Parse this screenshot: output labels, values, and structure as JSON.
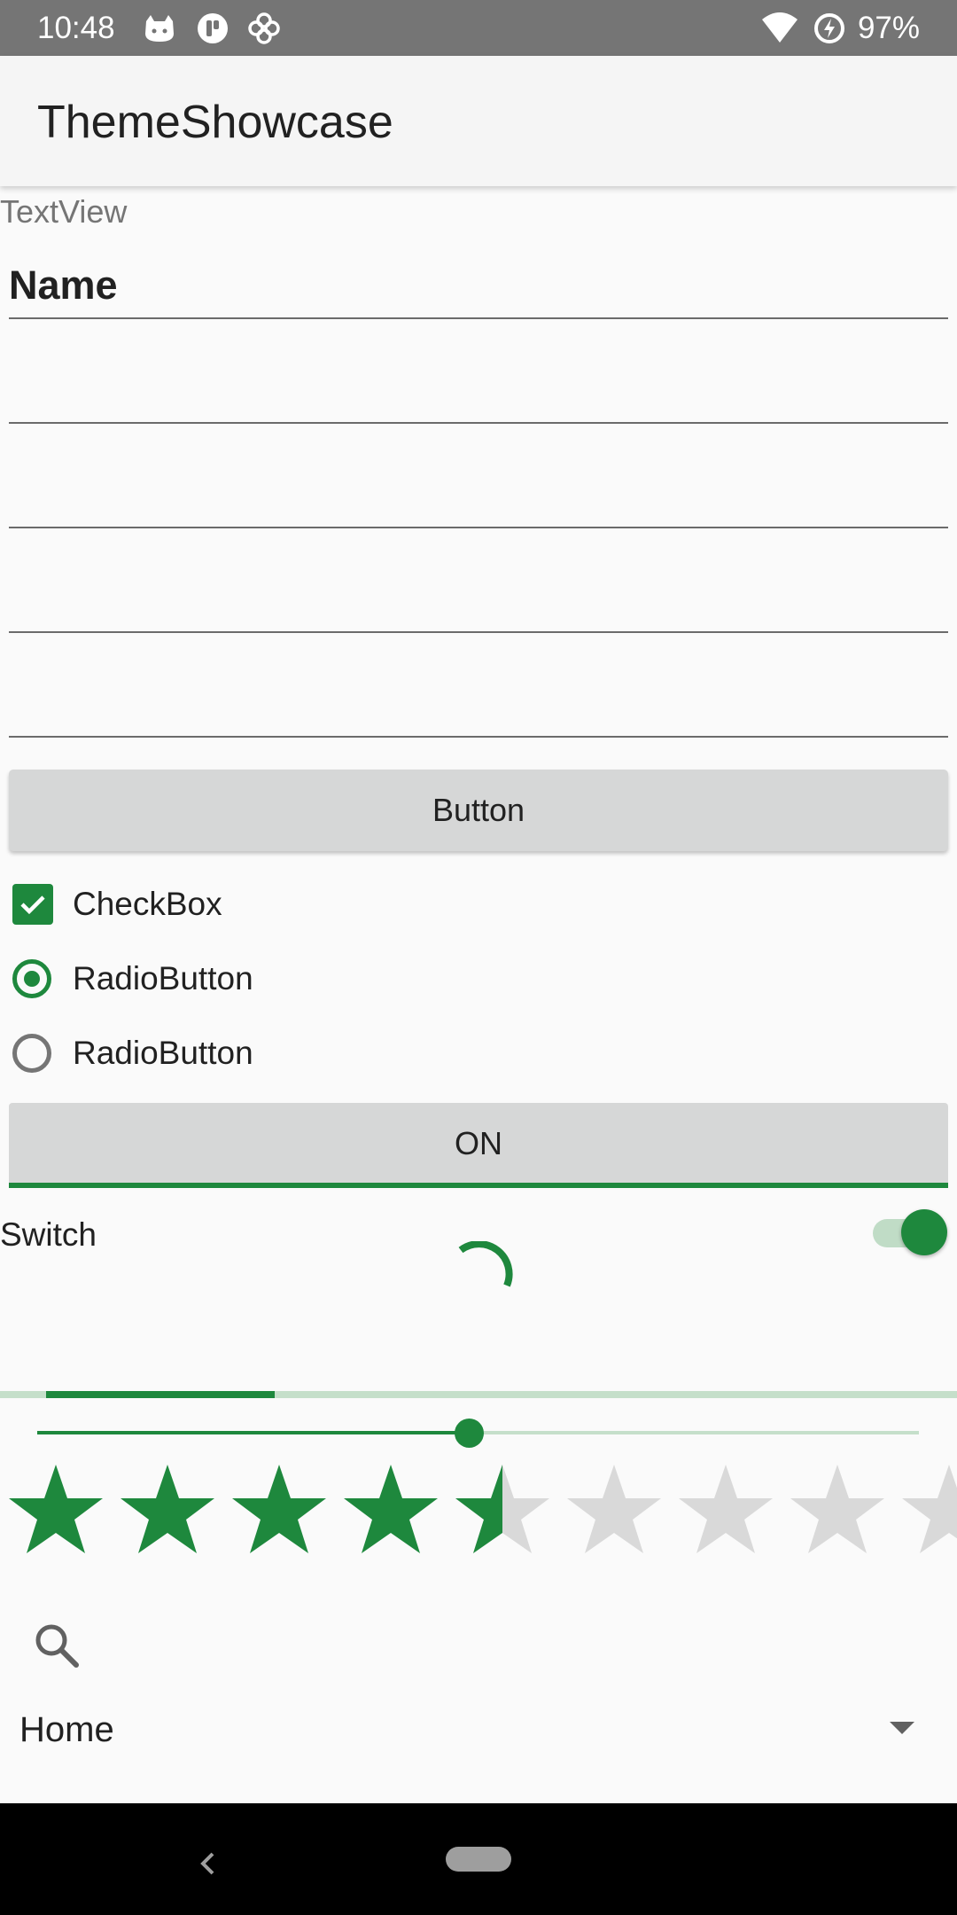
{
  "status_bar": {
    "time": "10:48",
    "battery_percent": "97%",
    "icons": [
      "cat-notification-icon",
      "podcast-notification-icon",
      "pinwheel-notification-icon",
      "wifi-icon",
      "battery-saver-icon"
    ]
  },
  "app_bar": {
    "title": "ThemeShowcase"
  },
  "content": {
    "textview_label": "TextView",
    "name_field_value": "Name",
    "empty_fields_count": 4,
    "button_label": "Button",
    "checkbox": {
      "label": "CheckBox",
      "checked": true
    },
    "radio_1": {
      "label": "RadioButton",
      "checked": true
    },
    "radio_2": {
      "label": "RadioButton",
      "checked": false
    },
    "toggle_button_label": "ON",
    "switch": {
      "label": "Switch",
      "on": true
    },
    "progress_fraction": 0.24,
    "slider_fraction": 0.49,
    "rating": {
      "value": 4.5,
      "max": 9
    },
    "spinner_selected": "Home"
  },
  "colors": {
    "accent": "#1e883d",
    "accent_light": "#c5dfca",
    "star_empty": "#d9d9d9",
    "button_bg": "#d6d7d7",
    "status_bar_bg": "#757575"
  }
}
